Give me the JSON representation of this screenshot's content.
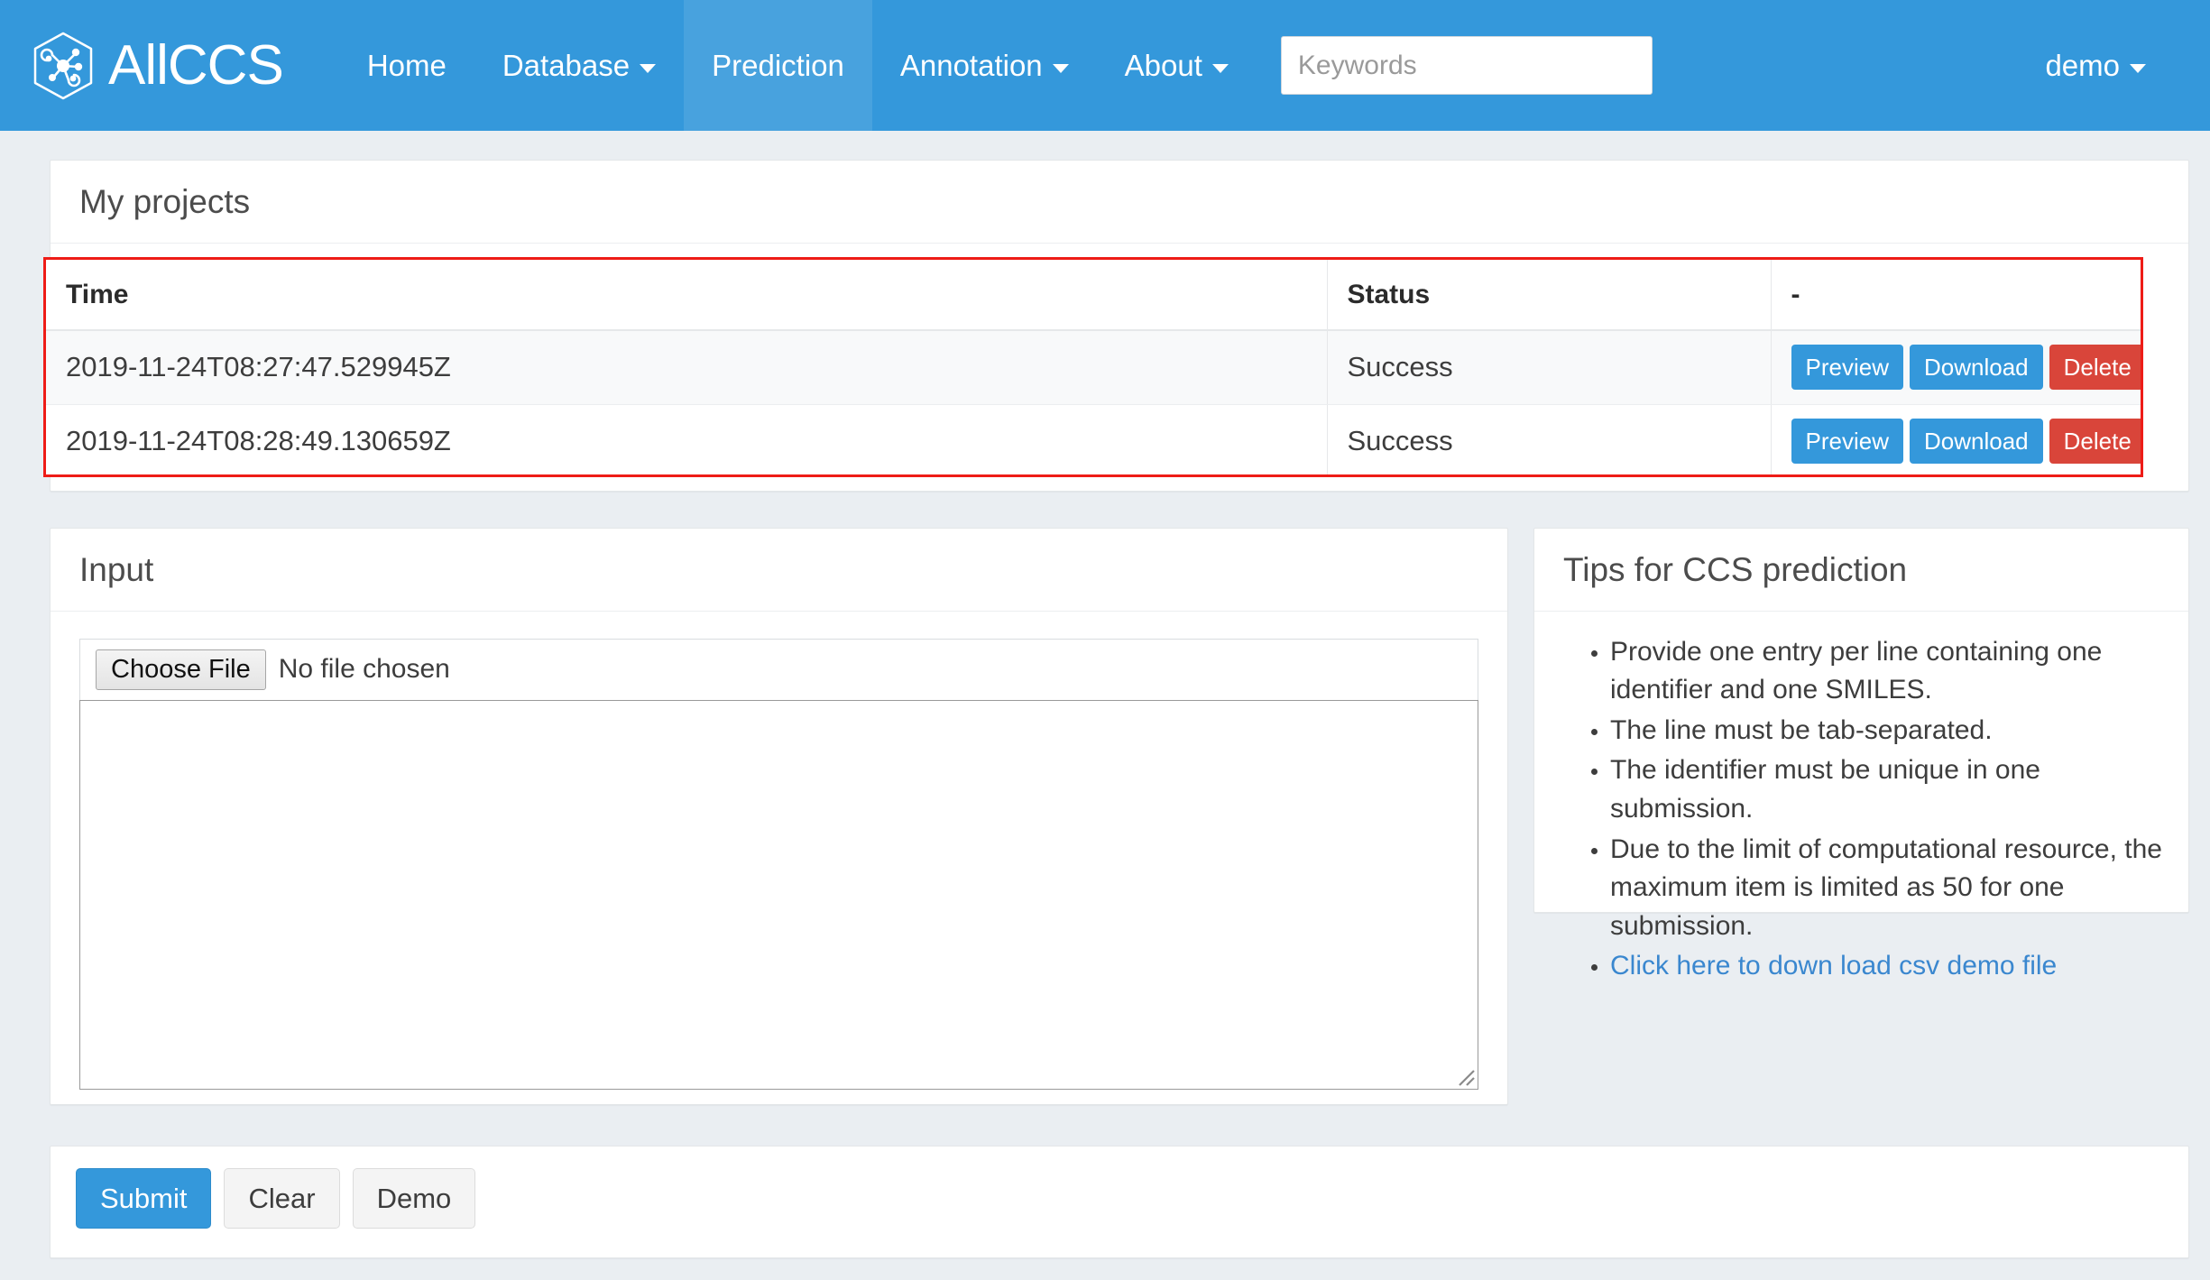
{
  "navbar": {
    "brand": {
      "text": "AllCCS",
      "logo_icon": "hexagon-molecule-logo"
    },
    "links": [
      {
        "label": "Home",
        "has_caret": false,
        "active": false
      },
      {
        "label": "Database",
        "has_caret": true,
        "active": false
      },
      {
        "label": "Prediction",
        "has_caret": false,
        "active": true
      },
      {
        "label": "Annotation",
        "has_caret": true,
        "active": false
      },
      {
        "label": "About",
        "has_caret": true,
        "active": false
      }
    ],
    "search": {
      "value": "",
      "placeholder": "Keywords"
    },
    "user": {
      "label": "demo",
      "has_caret": true
    }
  },
  "projects": {
    "title": "My projects",
    "columns": [
      "Time",
      "Status",
      "-"
    ],
    "rows": [
      {
        "time": "2019-11-24T08:27:47.529945Z",
        "status": "Success",
        "actions": [
          "Preview",
          "Download",
          "Delete"
        ]
      },
      {
        "time": "2019-11-24T08:28:49.130659Z",
        "status": "Success",
        "actions": [
          "Preview",
          "Download",
          "Delete"
        ]
      }
    ],
    "highlight_color": "#ee1c17"
  },
  "input": {
    "title": "Input",
    "file_button_label": "Choose File",
    "file_status": "No file chosen",
    "textarea_value": "",
    "textarea_placeholder": ""
  },
  "tips": {
    "title": "Tips for CCS prediction",
    "items": [
      {
        "text": "Provide one entry per line containing one identifier and one SMILES.",
        "link": false
      },
      {
        "text": "The line must be tab-separated.",
        "link": false
      },
      {
        "text": "The identifier must be unique in one submission.",
        "link": false
      },
      {
        "text": "Due to the limit of computational resource, the maximum item is limited as 50 for one submission.",
        "link": false
      },
      {
        "text": "Click here to down load csv demo file",
        "link": true
      }
    ]
  },
  "actions": {
    "submit_label": "Submit",
    "clear_label": "Clear",
    "demo_label": "Demo"
  },
  "colors": {
    "brand_blue": "#3498db",
    "danger_red": "#d9453a",
    "highlight_red": "#ee1c17",
    "page_bg": "#eaeef2",
    "link_blue": "#3a87cf"
  }
}
